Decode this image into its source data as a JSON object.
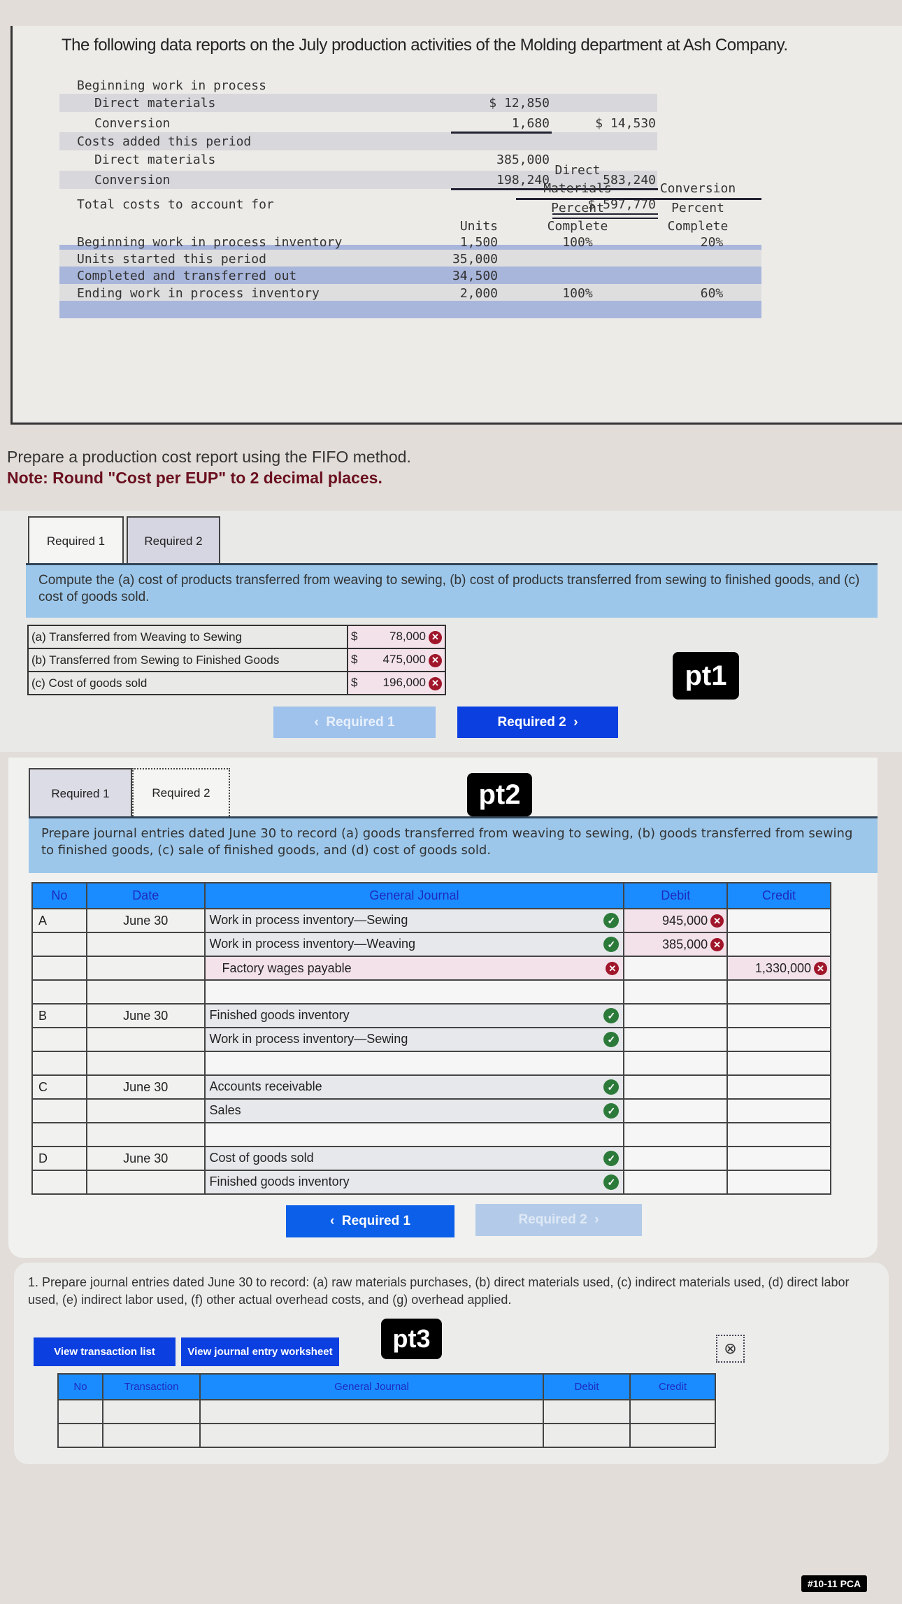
{
  "intro": "The following data reports on the July production activities of the Molding department at Ash Company.",
  "costs": {
    "rows": [
      {
        "label": "Beginning work in process",
        "indent": false,
        "c1": "",
        "c2": ""
      },
      {
        "label": "Direct materials",
        "indent": true,
        "c1": "$ 12,850",
        "c2": ""
      },
      {
        "label": "Conversion",
        "indent": true,
        "c1": "1,680",
        "c2": "$ 14,530"
      },
      {
        "label": "Costs added this period",
        "indent": false,
        "c1": "",
        "c2": ""
      },
      {
        "label": "Direct materials",
        "indent": true,
        "c1": "385,000",
        "c2": ""
      },
      {
        "label": "Conversion",
        "indent": true,
        "c1": "198,240",
        "c2": "583,240"
      },
      {
        "label": "Total costs to account for",
        "indent": false,
        "c1": "",
        "c2": "$ 597,770"
      }
    ]
  },
  "units": {
    "headers": {
      "units": "Units",
      "dm_top1": "Direct",
      "dm_top2": "Materials",
      "dm_pct1": "Percent",
      "dm_pct2": "Complete",
      "cv_top": "Conversion",
      "cv_pct1": "Percent",
      "cv_pct2": "Complete"
    },
    "rows": [
      {
        "label": "Beginning work in process inventory",
        "units": "1,500",
        "dm": "100%",
        "cv": "20%"
      },
      {
        "label": "Units started this period",
        "units": "35,000",
        "dm": "",
        "cv": ""
      },
      {
        "label": "Completed and transferred out",
        "units": "34,500",
        "dm": "",
        "cv": ""
      },
      {
        "label": "Ending work in process inventory",
        "units": "2,000",
        "dm": "100%",
        "cv": "60%"
      }
    ]
  },
  "prepare": "Prepare a production cost report using the FIFO method.",
  "note": "Note: Round \"Cost per EUP\" to 2 decimal places.",
  "pt1": {
    "tabs": [
      "Required 1",
      "Required 2"
    ],
    "instruction": "Compute the (a) cost of products transferred from weaving to sewing, (b) cost of products transferred from sewing to finished goods, and (c) cost of goods sold.",
    "rows": [
      {
        "label": "(a) Transferred from Weaving to Sewing",
        "cur": "$",
        "value": "78,000",
        "status": "incorrect"
      },
      {
        "label": "(b) Transferred from Sewing to Finished Goods",
        "cur": "$",
        "value": "475,000",
        "status": "incorrect"
      },
      {
        "label": "(c) Cost of goods sold",
        "cur": "$",
        "value": "196,000",
        "status": "incorrect"
      }
    ],
    "prev": "Required 1",
    "next": "Required 2",
    "badge": "pt1"
  },
  "pt2": {
    "tabs": [
      "Required 1",
      "Required 2"
    ],
    "badge": "pt2",
    "instruction": "Prepare journal entries dated June 30 to record (a) goods transferred from weaving to sewing, (b) goods transferred from sewing to finished goods, (c) sale of finished goods, and (d) cost of goods sold.",
    "headers": [
      "No",
      "Date",
      "General Journal",
      "Debit",
      "Credit"
    ],
    "rows": [
      {
        "no": "A",
        "date": "June 30",
        "account": "Work in process inventory—Sewing",
        "indent": false,
        "mark": "correct",
        "debit": "945,000",
        "debit_mark": "incorrect",
        "credit": "",
        "credit_mark": ""
      },
      {
        "no": "",
        "date": "",
        "account": "Work in process inventory—Weaving",
        "indent": false,
        "mark": "correct",
        "debit": "385,000",
        "debit_mark": "incorrect",
        "credit": "",
        "credit_mark": ""
      },
      {
        "no": "",
        "date": "",
        "account": "Factory wages payable",
        "indent": true,
        "mark": "incorrect",
        "debit": "",
        "debit_mark": "",
        "credit": "1,330,000",
        "credit_mark": "incorrect"
      },
      {
        "no": "",
        "date": "",
        "account": "",
        "indent": false,
        "mark": "",
        "debit": "",
        "debit_mark": "",
        "credit": "",
        "credit_mark": ""
      },
      {
        "no": "B",
        "date": "June 30",
        "account": "Finished goods inventory",
        "indent": false,
        "mark": "correct",
        "debit": "",
        "debit_mark": "",
        "credit": "",
        "credit_mark": ""
      },
      {
        "no": "",
        "date": "",
        "account": "Work in process inventory—Sewing",
        "indent": false,
        "mark": "correct",
        "debit": "",
        "debit_mark": "",
        "credit": "",
        "credit_mark": ""
      },
      {
        "no": "",
        "date": "",
        "account": "",
        "indent": false,
        "mark": "",
        "debit": "",
        "debit_mark": "",
        "credit": "",
        "credit_mark": ""
      },
      {
        "no": "C",
        "date": "June 30",
        "account": "Accounts receivable",
        "indent": false,
        "mark": "correct",
        "debit": "",
        "debit_mark": "",
        "credit": "",
        "credit_mark": ""
      },
      {
        "no": "",
        "date": "",
        "account": "Sales",
        "indent": false,
        "mark": "correct",
        "debit": "",
        "debit_mark": "",
        "credit": "",
        "credit_mark": ""
      },
      {
        "no": "",
        "date": "",
        "account": "",
        "indent": false,
        "mark": "",
        "debit": "",
        "debit_mark": "",
        "credit": "",
        "credit_mark": ""
      },
      {
        "no": "D",
        "date": "June 30",
        "account": "Cost of goods sold",
        "indent": false,
        "mark": "correct",
        "debit": "",
        "debit_mark": "",
        "credit": "",
        "credit_mark": ""
      },
      {
        "no": "",
        "date": "",
        "account": "Finished goods inventory",
        "indent": false,
        "mark": "correct",
        "debit": "",
        "debit_mark": "",
        "credit": "",
        "credit_mark": ""
      }
    ],
    "prev": "Required 1",
    "next": "Required 2"
  },
  "pt3": {
    "instruction": "1. Prepare journal entries dated June 30 to record: (a) raw materials purchases, (b) direct materials used, (c) indirect materials used, (d) direct labor used, (e) indirect labor used, (f) other actual overhead costs, and (g) overhead applied.",
    "btn_list": "View transaction list",
    "btn_ws": "View journal entry worksheet",
    "badge": "pt3",
    "headers": [
      "No",
      "Transaction",
      "General Journal",
      "Debit",
      "Credit"
    ]
  },
  "corner_badge": "#10-11 PCA",
  "colors": {
    "blue_btn": "#0b3fe0",
    "header_blue": "#1a8cff",
    "instr_band": "#9cc7ea",
    "error": "#a0152a",
    "ok": "#2c7a3a"
  }
}
